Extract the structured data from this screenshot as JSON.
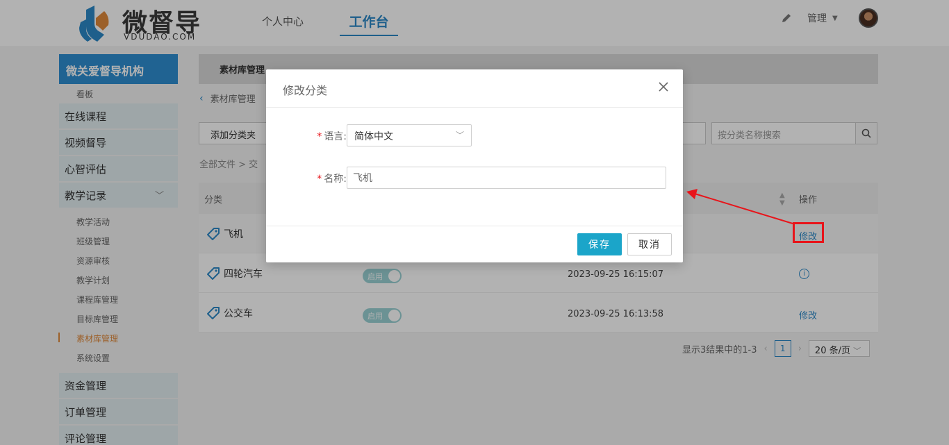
{
  "header": {
    "logo_name": "微督导",
    "logo_sub": "VDUDAO.COM",
    "nav": [
      "个人中心",
      "工作台"
    ],
    "admin_label": "管理"
  },
  "sidebar": {
    "org_title": "微关爱督导机构",
    "dashboard": "看板",
    "items": [
      "在线课程",
      "视频督导",
      "心智评估",
      "教学记录"
    ],
    "sub_items": [
      "教学活动",
      "班级管理",
      "资源审核",
      "教学计划",
      "课程库管理",
      "目标库管理",
      "素材库管理",
      "系统设置"
    ],
    "bottom_items": [
      "资金管理",
      "订单管理",
      "评论管理"
    ]
  },
  "main": {
    "tab": "素材库管理",
    "breadcrumb": "素材库管理",
    "add_button": "添加分类夹",
    "search_placeholder": "按分类名称搜索",
    "path": "全部文件 > 交",
    "table": {
      "col_category": "分类",
      "col_action": "操作",
      "rows": [
        {
          "name": "飞机",
          "status": "",
          "time": "",
          "action": "修改"
        },
        {
          "name": "四轮汽车",
          "status": "启用",
          "time": "2023-09-25 16:15:07",
          "action": ""
        },
        {
          "name": "公交车",
          "status": "启用",
          "time": "2023-09-25 16:13:58",
          "action": "修改"
        }
      ]
    },
    "pagination": {
      "summary": "显示3结果中的1-3",
      "page": "1",
      "page_size": "20 条/页"
    }
  },
  "modal": {
    "title": "修改分类",
    "language_label": "语言:",
    "language_value": "简体中文",
    "name_label": "名称:",
    "name_value": "飞机",
    "required_mark": "*",
    "save": "保存",
    "cancel": "取消"
  },
  "colors": {
    "primary": "#2c89c8",
    "save_button": "#1ba5c9",
    "annotation": "#e8141a"
  }
}
